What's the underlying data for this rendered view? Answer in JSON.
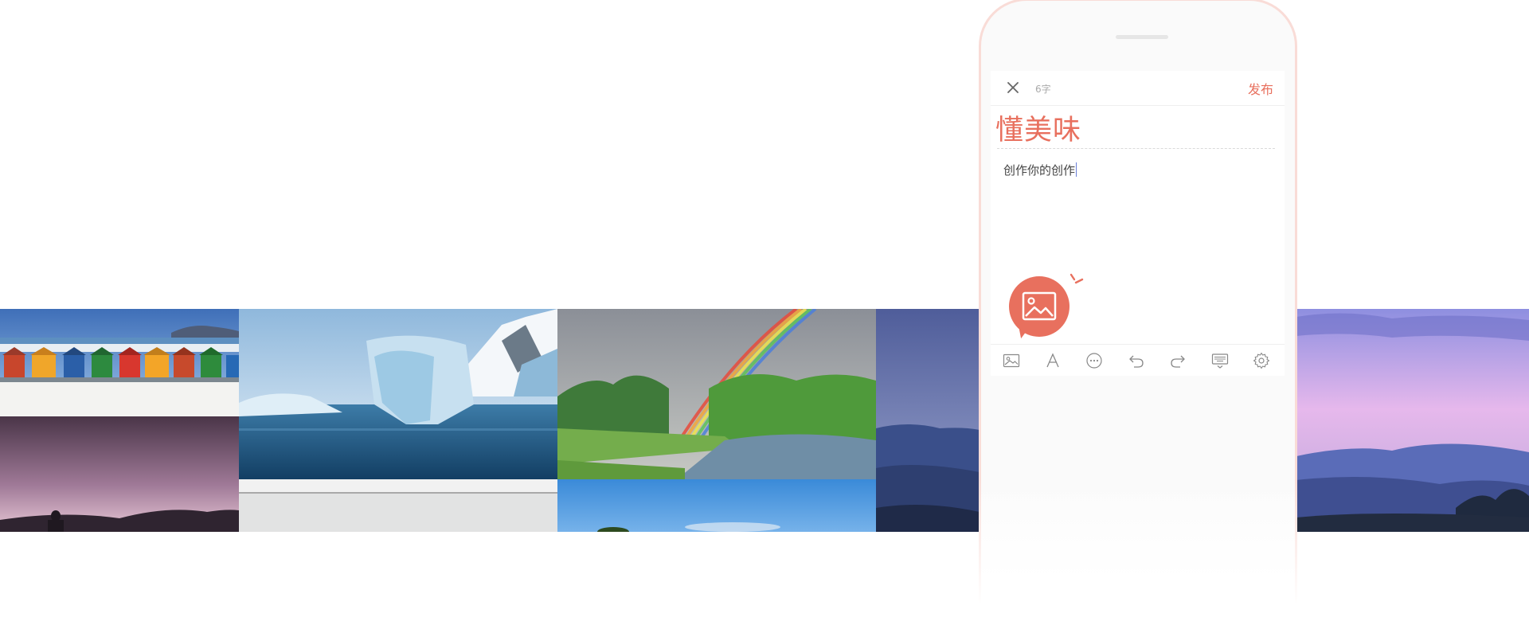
{
  "editor": {
    "word_count": "6字",
    "publish_label": "发布",
    "title": "懂美味",
    "body": "创作你的创作"
  },
  "icons": {
    "close": "close-icon",
    "insert_image_bubble": "image-icon",
    "toolbar": [
      "image-icon",
      "font-icon",
      "more-icon",
      "undo-icon",
      "redo-icon",
      "keyboard-icon",
      "gear-icon"
    ]
  },
  "colors": {
    "accent": "#e8705e",
    "phone_border": "#f9dcd7"
  },
  "photos": [
    "beach-huts",
    "sunset-silhouette",
    "iceberg",
    "rainbow-river",
    "blue-sky",
    "blue-mountains",
    "purple-mountains"
  ]
}
